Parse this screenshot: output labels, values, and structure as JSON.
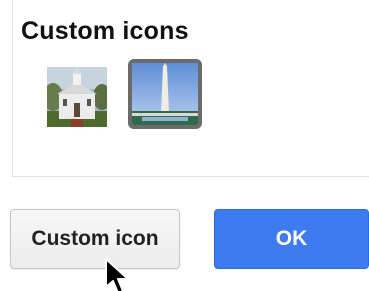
{
  "dialog": {
    "section_title": "Custom icons",
    "icons": [
      {
        "name": "church",
        "selected": false
      },
      {
        "name": "washington-monument",
        "selected": true
      }
    ]
  },
  "buttons": {
    "custom_icon_label": "Custom icon",
    "ok_label": "OK"
  },
  "colors": {
    "ok_button_bg": "#3e7bf0",
    "selected_border": "#6b6b6b",
    "custom_button_bg": "#efefef"
  }
}
